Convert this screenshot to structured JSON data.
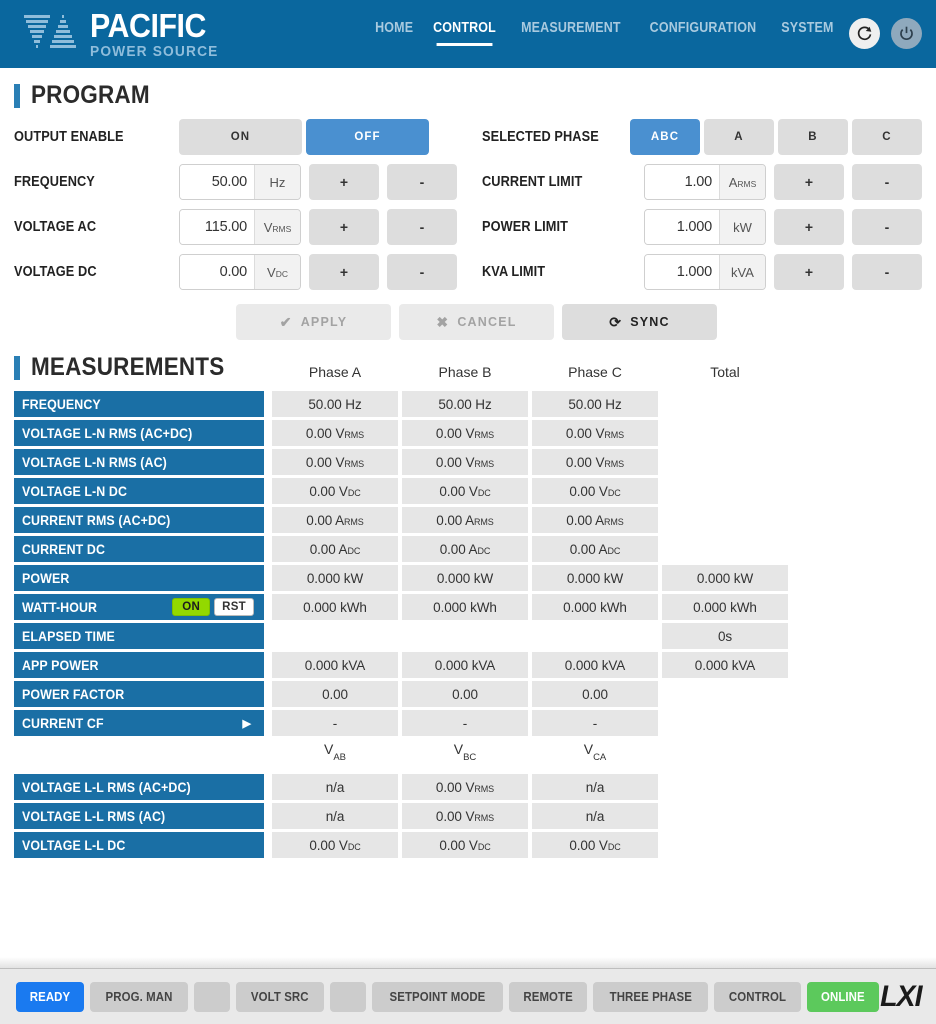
{
  "header": {
    "brand_main": "PACIFIC",
    "brand_sub": "POWER SOURCE",
    "brand_color": "#0a679e",
    "nav": [
      {
        "label": "HOME",
        "active": false
      },
      {
        "label": "CONTROL",
        "active": true
      },
      {
        "label": "MEASUREMENT",
        "active": false
      },
      {
        "label": "CONFIGURATION",
        "active": false
      },
      {
        "label": "SYSTEM",
        "active": false
      }
    ],
    "refresh_icon": "refresh-icon",
    "power_icon": "power-icon"
  },
  "program": {
    "title": "PROGRAM",
    "output_enable": {
      "label": "OUTPUT ENABLE",
      "options": [
        "ON",
        "OFF"
      ],
      "selected": "OFF"
    },
    "selected_phase": {
      "label": "SELECTED PHASE",
      "options": [
        "ABC",
        "A",
        "B",
        "C"
      ],
      "selected": "ABC"
    },
    "fields_left": [
      {
        "label": "FREQUENCY",
        "value": "50.00",
        "unit": "Hz",
        "unit_sub": "",
        "plus": "+",
        "minus": "-"
      },
      {
        "label": "VOLTAGE AC",
        "value": "115.00",
        "unit": "V",
        "unit_sub": "RMS",
        "plus": "+",
        "minus": "-"
      },
      {
        "label": "VOLTAGE DC",
        "value": "0.00",
        "unit": "V",
        "unit_sub": "DC",
        "plus": "+",
        "minus": "-"
      }
    ],
    "fields_right": [
      {
        "label": "CURRENT LIMIT",
        "value": "1.00",
        "unit": "A",
        "unit_sub": "RMS",
        "plus": "+",
        "minus": "-"
      },
      {
        "label": "POWER LIMIT",
        "value": "1.000",
        "unit": "kW",
        "unit_sub": "",
        "plus": "+",
        "minus": "-"
      },
      {
        "label": "KVA LIMIT",
        "value": "1.000",
        "unit": "kVA",
        "unit_sub": "",
        "plus": "+",
        "minus": "-"
      }
    ],
    "actions": [
      {
        "label": "APPLY",
        "icon": "check-icon",
        "glyph": "✔",
        "enabled": false
      },
      {
        "label": "CANCEL",
        "icon": "cross-icon",
        "glyph": "✖",
        "enabled": false
      },
      {
        "label": "SYNC",
        "icon": "sync-icon",
        "glyph": "⟳",
        "enabled": true
      }
    ]
  },
  "measurements": {
    "title": "MEASUREMENTS",
    "columns": [
      "Phase A",
      "Phase B",
      "Phase C",
      "Total"
    ],
    "ll_columns": [
      {
        "main": "V",
        "sub": "AB"
      },
      {
        "main": "V",
        "sub": "BC"
      },
      {
        "main": "V",
        "sub": "CA"
      }
    ],
    "rows": [
      {
        "label": "FREQUENCY",
        "a": "50.00 Hz",
        "b": "50.00 Hz",
        "c": "50.00 Hz",
        "total": null
      },
      {
        "label": "VOLTAGE L-N RMS (AC+DC)",
        "a": "0.00 V",
        "a_sub": "RMS",
        "b": "0.00 V",
        "b_sub": "RMS",
        "c": "0.00 V",
        "c_sub": "RMS",
        "total": null
      },
      {
        "label": "VOLTAGE L-N RMS (AC)",
        "a": "0.00 V",
        "a_sub": "RMS",
        "b": "0.00 V",
        "b_sub": "RMS",
        "c": "0.00 V",
        "c_sub": "RMS",
        "total": null
      },
      {
        "label": "VOLTAGE L-N DC",
        "a": "0.00 V",
        "a_sub": "DC",
        "b": "0.00 V",
        "b_sub": "DC",
        "c": "0.00 V",
        "c_sub": "DC",
        "total": null
      },
      {
        "label": "CURRENT RMS (AC+DC)",
        "a": "0.00 A",
        "a_sub": "RMS",
        "b": "0.00 A",
        "b_sub": "RMS",
        "c": "0.00 A",
        "c_sub": "RMS",
        "total": null
      },
      {
        "label": "CURRENT DC",
        "a": "0.00 A",
        "a_sub": "DC",
        "b": "0.00 A",
        "b_sub": "DC",
        "c": "0.00 A",
        "c_sub": "DC",
        "total": null
      },
      {
        "label": "POWER",
        "a": "0.000 kW",
        "b": "0.000 kW",
        "c": "0.000 kW",
        "total": "0.000 kW"
      },
      {
        "label": "WATT-HOUR",
        "a": "0.000 kWh",
        "b": "0.000 kWh",
        "c": "0.000 kWh",
        "total": "0.000 kWh",
        "control": "watt-hour-toggle",
        "on_label": "ON",
        "rst_label": "RST"
      },
      {
        "label": "ELAPSED TIME",
        "a": "",
        "b": "",
        "c": "",
        "total": "0s",
        "blank_phases": true
      },
      {
        "label": "APP POWER",
        "a": "0.000 kVA",
        "b": "0.000 kVA",
        "c": "0.000 kVA",
        "total": "0.000 kVA"
      },
      {
        "label": "POWER FACTOR",
        "a": "0.00",
        "b": "0.00",
        "c": "0.00",
        "total": null
      },
      {
        "label": "CURRENT CF",
        "a": "-",
        "b": "-",
        "c": "-",
        "total": null,
        "expand": "▶"
      }
    ],
    "ll_rows": [
      {
        "label": "VOLTAGE L-L RMS (AC+DC)",
        "ab": "n/a",
        "bc": "0.00 V",
        "bc_sub": "RMS",
        "ca": "n/a"
      },
      {
        "label": "VOLTAGE L-L RMS (AC)",
        "ab": "n/a",
        "bc": "0.00 V",
        "bc_sub": "RMS",
        "ca": "n/a"
      },
      {
        "label": "VOLTAGE L-L DC",
        "ab": "0.00 V",
        "ab_sub": "DC",
        "bc": "0.00 V",
        "bc_sub": "DC",
        "ca": "0.00 V",
        "ca_sub": "DC"
      }
    ]
  },
  "statusbar": {
    "chips": [
      {
        "label": "READY",
        "style": "ready"
      },
      {
        "label": "PROG. MAN",
        "style": "normal"
      },
      {
        "label": "",
        "style": "blank"
      },
      {
        "label": "VOLT SRC",
        "style": "normal"
      },
      {
        "label": "",
        "style": "blank"
      },
      {
        "label": "SETPOINT MODE",
        "style": "normal"
      },
      {
        "label": "REMOTE",
        "style": "normal"
      },
      {
        "label": "THREE PHASE",
        "style": "normal"
      },
      {
        "label": "CONTROL",
        "style": "normal"
      },
      {
        "label": "ONLINE",
        "style": "online"
      }
    ],
    "logo": "LXI"
  }
}
